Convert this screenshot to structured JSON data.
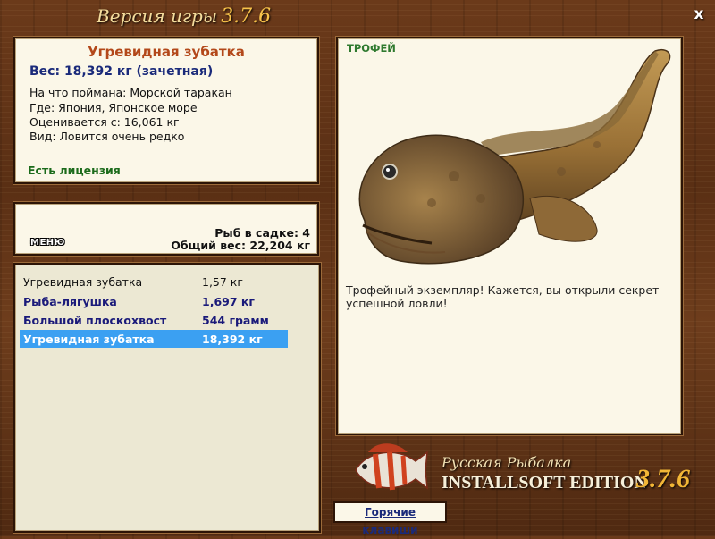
{
  "window": {
    "title": "Версия игры",
    "version": "3.7.6",
    "close_label": "x"
  },
  "fish_info": {
    "name": "Угревидная зубатка",
    "weight": "Вес: 18,392 кг (зачетная)",
    "lines": [
      "На что поймана: Морской таракан",
      "Где: Япония, Японское море",
      "Оценивается с: 16,061 кг",
      "Вид: Ловится очень редко"
    ],
    "license": "Есть лицензия"
  },
  "keep_net": {
    "menu_label": "МЕНЮ",
    "count": "Рыб в садке: 4",
    "total": "Общий вес: 22,204 кг"
  },
  "catch_list": [
    {
      "name": "Угревидная зубатка",
      "weight": "1,57 кг",
      "style": "normal"
    },
    {
      "name": "Рыба-лягушка",
      "weight": "1,697 кг",
      "style": "bold"
    },
    {
      "name": "Большой плоскохвост",
      "weight": "544 грамм",
      "style": "bold"
    },
    {
      "name": "Угревидная зубатка",
      "weight": "18,392 кг",
      "style": "selected"
    }
  ],
  "trophy": {
    "label": "ТРОФЕЙ",
    "description": "Трофейный экземпляр! Кажется, вы открыли секрет успешной ловли!"
  },
  "logo": {
    "title": "Русская Рыбалка",
    "edition": "INSTALLSOFT EDITION",
    "version": "3.7.6"
  },
  "hotkeys_label": "Горячие клавиши",
  "colors": {
    "accent_selected": "#3ba0f2",
    "fish_name": "#b3481a",
    "license": "#1b6b1b",
    "trophy": "#2f7a2f"
  }
}
